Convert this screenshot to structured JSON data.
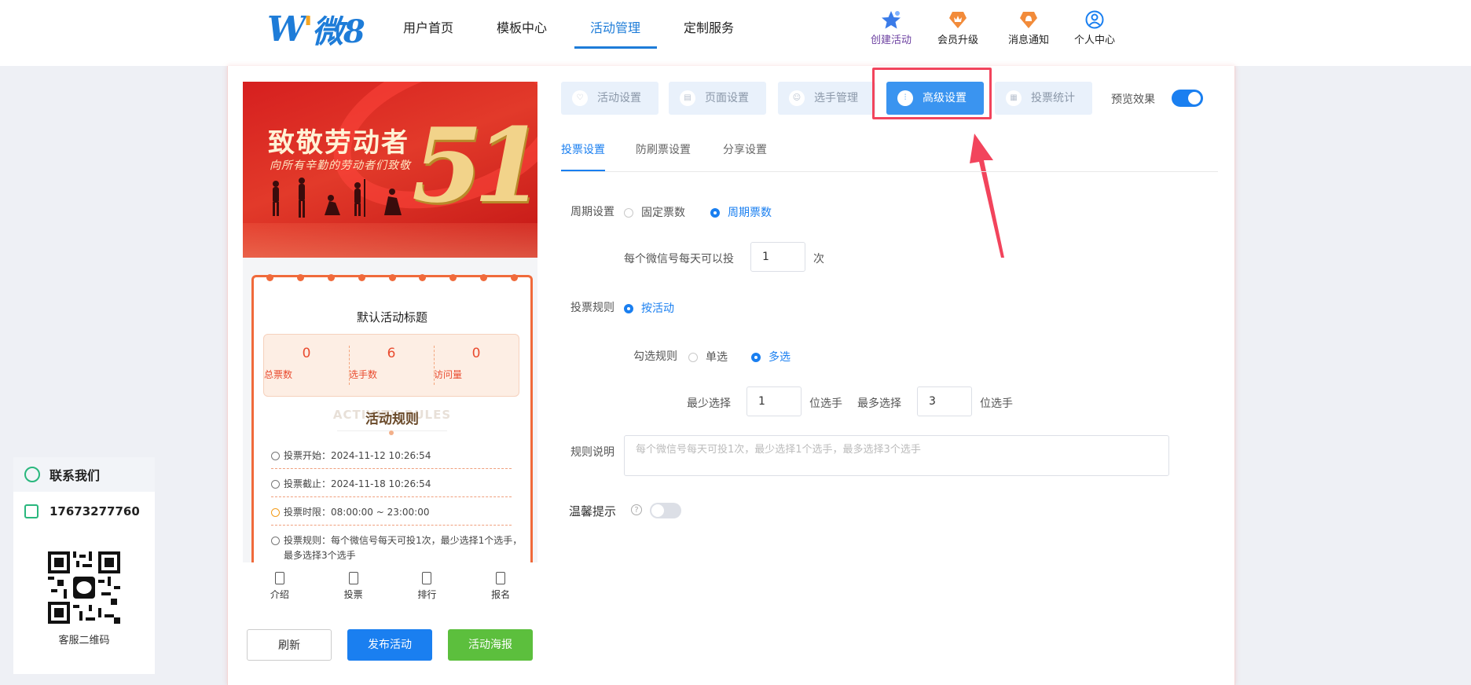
{
  "nav": {
    "logo_text": "微8",
    "items": [
      "用户首页",
      "模板中心",
      "活动管理",
      "定制服务"
    ],
    "tools": [
      "创建活动",
      "会员升级",
      "消息通知",
      "个人中心"
    ]
  },
  "preview": {
    "banner_title": "致敬劳动者",
    "banner_sub": "向所有辛勤的劳动者们致敬",
    "banner_num": "51",
    "activity_title": "默认活动标题",
    "stats": [
      {
        "value": "0",
        "label": "总票数"
      },
      {
        "value": "6",
        "label": "选手数"
      },
      {
        "value": "0",
        "label": "访问量"
      }
    ],
    "rules_ghost": "ACTIVITY RULES",
    "rules_title": "活动规则",
    "rules": [
      "投票开始：2024-11-12 10:26:54",
      "投票截止：2024-11-18 10:26:54",
      "投票时限：08:00:00 ~ 23:00:00",
      "投票规则：每个微信号每天可投1次，最少选择1个选手，最多选择3个选手"
    ],
    "tabs": [
      "介绍",
      "投票",
      "排行",
      "报名"
    ],
    "buttons": {
      "refresh": "刷新",
      "publish": "发布活动",
      "poster": "活动海报"
    }
  },
  "steps": [
    "活动设置",
    "页面设置",
    "选手管理",
    "高级设置",
    "投票统计"
  ],
  "preview_toggle_label": "预览效果",
  "subtabs": [
    "投票设置",
    "防刷票设置",
    "分享设置"
  ],
  "form": {
    "cycle_label": "周期设置",
    "cycle_opt1": "固定票数",
    "cycle_opt2": "周期票数",
    "daily_label": "每个微信号每天可以投",
    "daily_value": "1",
    "daily_unit": "次",
    "rule_label": "投票规则",
    "rule_opt": "按活动",
    "check_label": "勾选规则",
    "check_opt1": "单选",
    "check_opt2": "多选",
    "min_label": "最少选择",
    "min_value": "1",
    "min_unit": "位选手",
    "max_label": "最多选择",
    "max_value": "3",
    "max_unit": "位选手",
    "desc_label": "规则说明",
    "desc_placeholder": "每个微信号每天可投1次，最少选择1个选手，最多选择3个选手",
    "tip_label": "温馨提示"
  },
  "contact": {
    "title": "联系我们",
    "phone": "17673277760",
    "qr_caption": "客服二维码"
  }
}
